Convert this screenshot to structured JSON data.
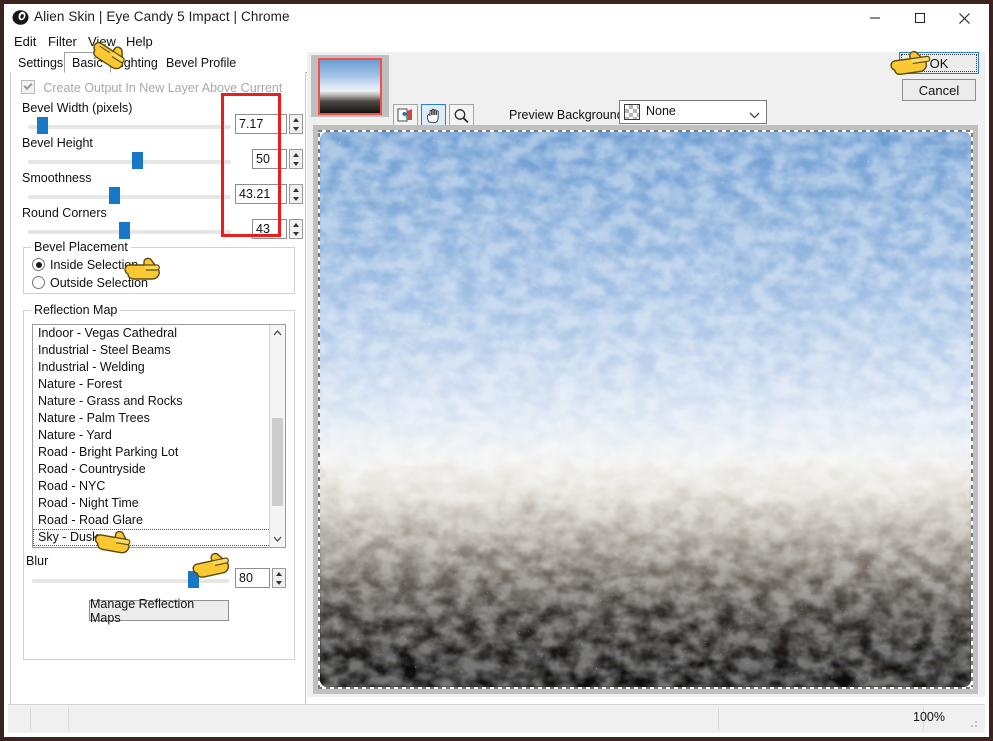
{
  "window": {
    "title": "Alien Skin | Eye Candy 5 Impact | Chrome",
    "icon": "alien-skin-eye-icon",
    "minimize": "–",
    "maximize": "□",
    "close": "✕"
  },
  "menubar": {
    "items": [
      {
        "label": "Edit"
      },
      {
        "label": "Filter"
      },
      {
        "label": "View"
      },
      {
        "label": "Help"
      }
    ]
  },
  "tabs": [
    {
      "label": "Settings",
      "selected": false
    },
    {
      "label": "Basic",
      "selected": true
    },
    {
      "label": "Lighting",
      "selected": false
    },
    {
      "label": "Bevel Profile",
      "selected": false
    }
  ],
  "basic": {
    "create_output_checkbox": {
      "label": "Create Output In New Layer Above Current",
      "checked": true,
      "disabled": true
    },
    "sliders": [
      {
        "label": "Bevel Width (pixels)",
        "value": "7.17",
        "percent": 10
      },
      {
        "label": "Bevel Height",
        "value": "50",
        "percent": 50
      },
      {
        "label": "Smoothness",
        "value": "43.21",
        "percent": 38
      },
      {
        "label": "Round Corners",
        "value": "43",
        "percent": 43
      }
    ]
  },
  "bevel_placement": {
    "title": "Bevel Placement",
    "options": [
      {
        "label": "Inside Selection",
        "selected": true
      },
      {
        "label": "Outside Selection",
        "selected": false
      }
    ]
  },
  "reflection_map": {
    "title": "Reflection Map",
    "items": [
      "Indoor - Vegas Cathedral",
      "Industrial - Steel Beams",
      "Industrial - Welding",
      "Nature - Forest",
      "Nature - Grass and Rocks",
      "Nature - Palm Trees",
      "Nature - Yard",
      "Road - Bright Parking Lot",
      "Road - Countryside",
      "Road - NYC",
      "Road - Night Time",
      "Road - Road Glare",
      "Sky - Dusk"
    ],
    "selected": "Sky - Dusk",
    "blur": {
      "label": "Blur",
      "value": "80",
      "percent": 80
    },
    "manage_button": "Manage Reflection Maps"
  },
  "preview": {
    "tools": [
      {
        "name": "eyedropper-tool",
        "selected": false
      },
      {
        "name": "hand-tool",
        "selected": true
      },
      {
        "name": "zoom-tool",
        "selected": false
      }
    ],
    "background_label": "Preview Background:",
    "background_value": "None",
    "thumbnail_name": "navigator-thumbnail"
  },
  "buttons": {
    "ok": "OK",
    "cancel": "Cancel"
  },
  "statusbar": {
    "zoom": "100%"
  },
  "annotation": {
    "accent_color": "#ee1c1c",
    "pointer_color": "#ffcc22"
  }
}
